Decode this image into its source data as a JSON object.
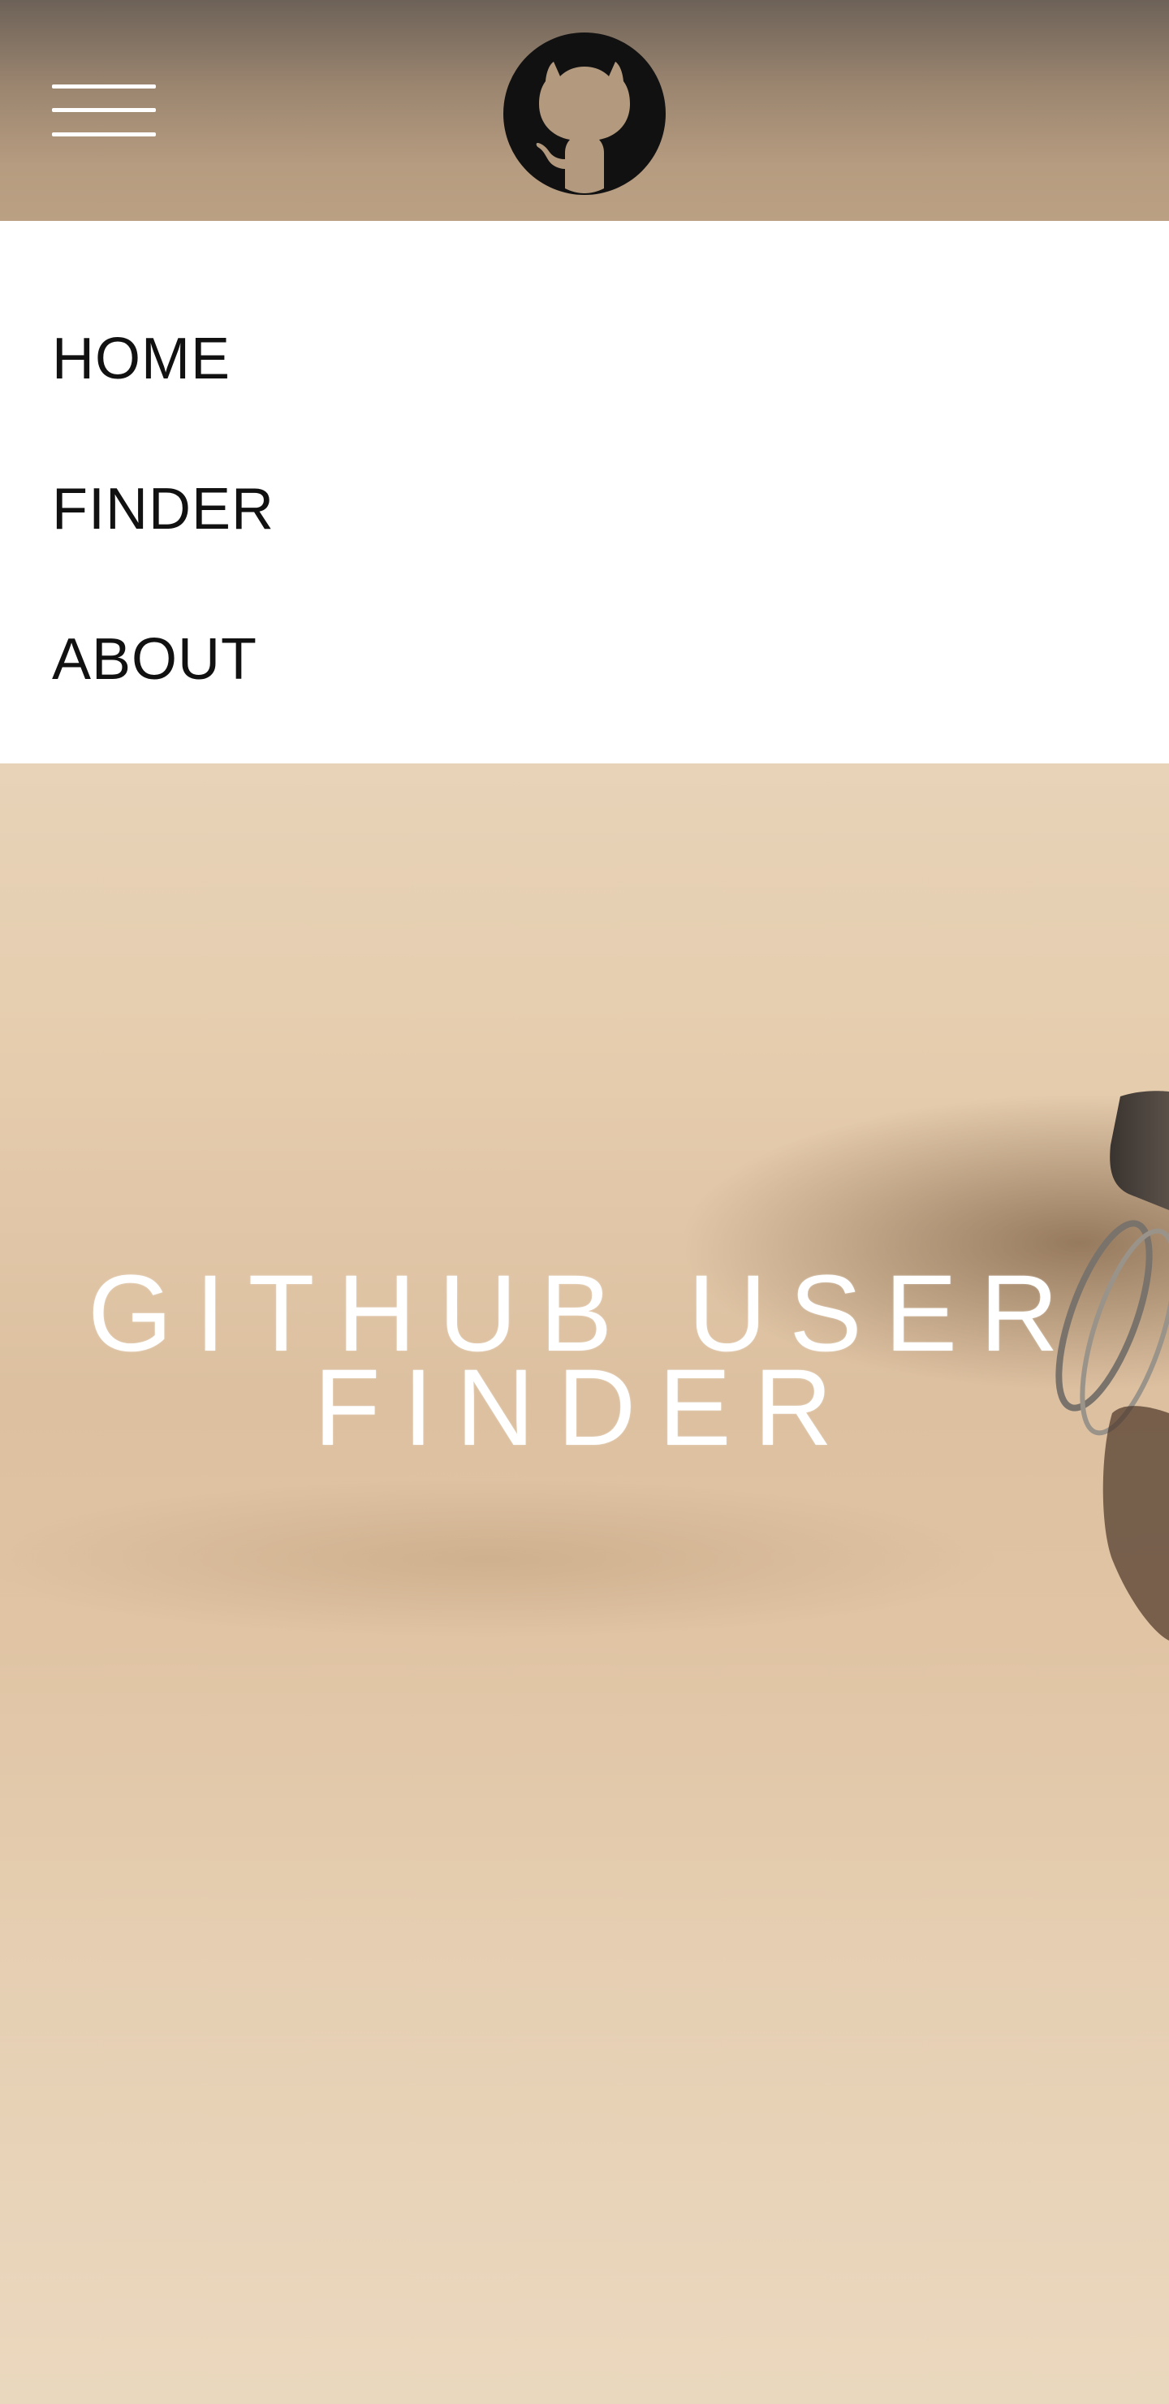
{
  "header": {
    "menu_icon": "hamburger-icon",
    "logo_icon": "github-octocat-icon"
  },
  "nav": {
    "items": [
      {
        "label": "HOME"
      },
      {
        "label": "FINDER"
      },
      {
        "label": "ABOUT"
      }
    ]
  },
  "hero": {
    "title_line1": "GITHUB USER",
    "title_line2": "FINDER"
  },
  "colors": {
    "menu_background": "#ffffff",
    "menu_text": "#111111",
    "hero_text": "#ffffff",
    "logo": "#111111"
  }
}
